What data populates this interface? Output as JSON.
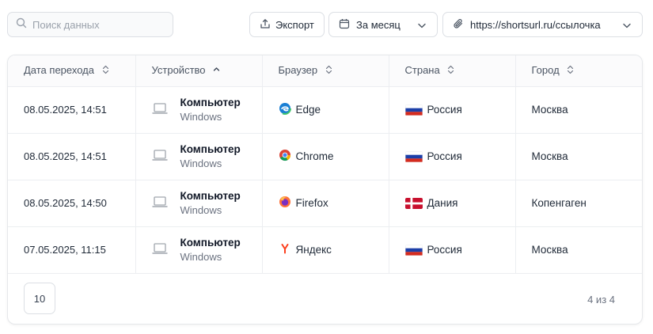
{
  "toolbar": {
    "search_placeholder": "Поиск данных",
    "export_label": "Экспорт",
    "period_label": "За месяц",
    "link_label": "https://shortsurl.ru/ссылочка"
  },
  "table": {
    "columns": [
      "Дата перехода",
      "Устройство",
      "Браузер",
      "Страна",
      "Город"
    ],
    "rows": [
      {
        "date": "08.05.2025, 14:51",
        "device": "Компьютер",
        "os": "Windows",
        "browser": "Edge",
        "browser_icon": "edge-icon",
        "country": "Россия",
        "flag": "russia-flag-icon",
        "city": "Москва"
      },
      {
        "date": "08.05.2025, 14:51",
        "device": "Компьютер",
        "os": "Windows",
        "browser": "Chrome",
        "browser_icon": "chrome-icon",
        "country": "Россия",
        "flag": "russia-flag-icon",
        "city": "Москва"
      },
      {
        "date": "08.05.2025, 14:50",
        "device": "Компьютер",
        "os": "Windows",
        "browser": "Firefox",
        "browser_icon": "firefox-icon",
        "country": "Дания",
        "flag": "denmark-flag-icon",
        "city": "Копенгаген"
      },
      {
        "date": "07.05.2025, 11:15",
        "device": "Компьютер",
        "os": "Windows",
        "browser": "Яндекс",
        "browser_icon": "yandex-icon",
        "country": "Россия",
        "flag": "russia-flag-icon",
        "city": "Москва"
      }
    ]
  },
  "footer": {
    "page_size": "10",
    "count_text": "4 из 4"
  },
  "colors": {
    "border": "#dcdfe4",
    "muted_text": "#6b7280",
    "icon_gray": "#9aa1ab"
  }
}
